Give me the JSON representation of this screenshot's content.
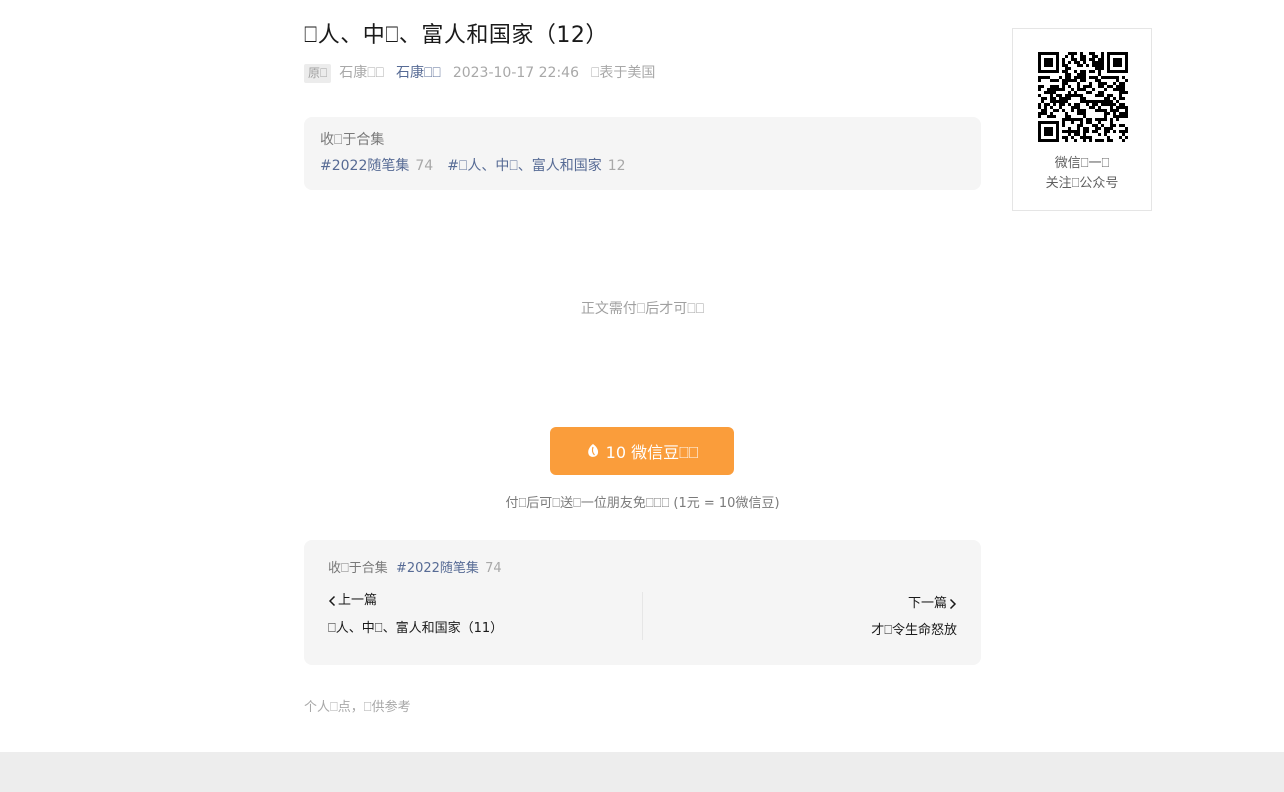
{
  "article": {
    "title": "⎕人、中⎕、富人和国家（12）",
    "meta": {
      "badge": "原⎕",
      "author": "石康⎕⎕",
      "account": "石康⎕⎕",
      "time": "2023-10-17 22:46",
      "location": "⎕表于美国"
    },
    "album_box": {
      "head": "收⎕于合集",
      "tags": [
        {
          "label": "#2022随笔集",
          "count": "74"
        },
        {
          "label": "#⎕人、中⎕、富人和国家",
          "count": "12"
        }
      ]
    },
    "paywall_text": "正文需付⎕后才可⎕⎕",
    "pay_button": {
      "label": "10 微信豆⎕⎕",
      "icon": "bean-icon"
    },
    "gift_note": "付⎕后可⎕送⎕一位朋友免⎕⎕⎕ (1元 = 10微信豆)",
    "album_nav": {
      "head": "收⎕于合集",
      "tag": "#2022随笔集",
      "count": "74",
      "prev_label": "上一篇",
      "prev_title": "⎕人、中⎕、富人和国家（11）",
      "next_label": "下一篇",
      "next_title": "才⎕令生命怒放"
    },
    "footnote": "个人⎕点，⎕供参考"
  },
  "qr_card": {
    "caption_line1": "微信⎕一⎕",
    "caption_line2": "关注⎕公众号"
  },
  "colors": {
    "accent_orange": "#fa9d3b",
    "link_blue": "#576b95",
    "muted_gray": "#a8a8a8",
    "panel_bg": "#f5f5f5"
  }
}
